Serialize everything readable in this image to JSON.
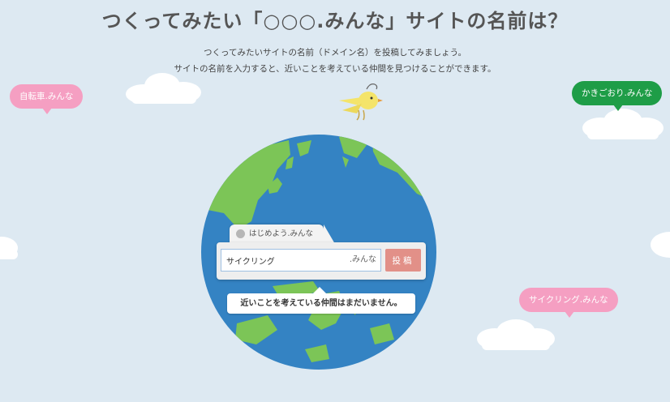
{
  "header": {
    "title": "つくってみたい「○○○.みんな」サイトの名前は？",
    "description_line1": "つくってみたいサイトの名前（ドメイン名）を投稿してみましょう。",
    "description_line2": "サイトの名前を入力すると、近いことを考えている仲間を見つけることができます。"
  },
  "bubbles": [
    {
      "label": "自転車.みんな",
      "color": "#f59fc2"
    },
    {
      "label": "かきごおり.みんな",
      "color": "#1e9d47"
    },
    {
      "label": "サイクリング.みんな",
      "color": "#f59fc2"
    }
  ],
  "form": {
    "tab_label": "はじめよう.みんな",
    "input_value": "サイクリング",
    "suffix": ".みんな",
    "submit_label": "投稿"
  },
  "result": {
    "message": "近いことを考えている仲間はまだいません。"
  },
  "colors": {
    "background": "#dde9f2",
    "ocean": "#3483c3",
    "land": "#7cc557",
    "submit": "#e29088"
  },
  "icons": {
    "tab_icon": "globe-icon",
    "mascot": "bird-icon"
  }
}
